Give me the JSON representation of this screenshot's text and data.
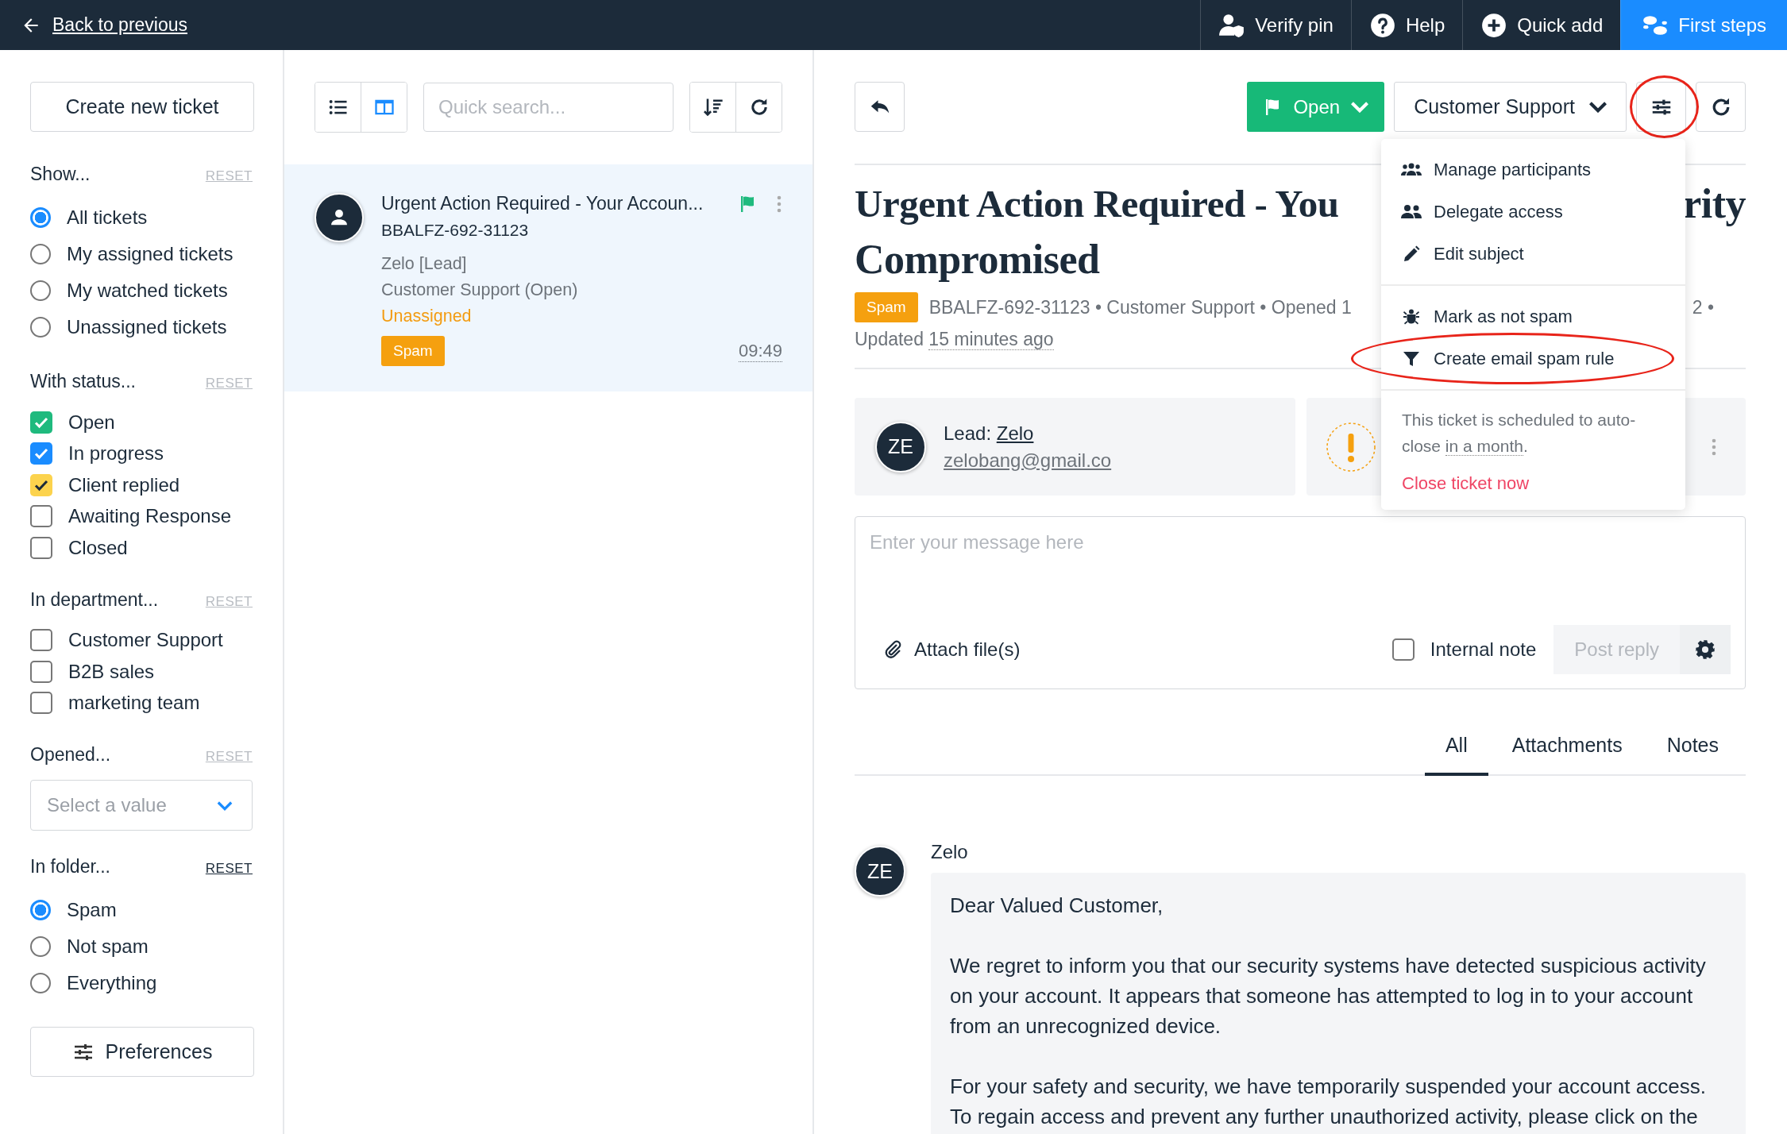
{
  "topbar": {
    "back": "Back to previous",
    "actions": [
      {
        "label": "Verify pin",
        "kind": "pin",
        "highlighted": false
      },
      {
        "label": "Help",
        "kind": "help",
        "highlighted": false
      },
      {
        "label": "Quick add",
        "kind": "add",
        "highlighted": false
      },
      {
        "label": "First steps",
        "kind": "steps",
        "highlighted": true
      }
    ]
  },
  "sidebar": {
    "create_button": "Create new ticket",
    "filters": [
      {
        "title": "Show...",
        "reset": "RESET",
        "reset_enabled": false,
        "kind": "radio",
        "options": [
          {
            "label": "All tickets",
            "selected": true
          },
          {
            "label": "My assigned tickets",
            "selected": false
          },
          {
            "label": "My watched tickets",
            "selected": false
          },
          {
            "label": "Unassigned tickets",
            "selected": false
          }
        ]
      },
      {
        "title": "With status...",
        "reset": "RESET",
        "reset_enabled": false,
        "kind": "checkbox",
        "options": [
          {
            "label": "Open",
            "checked": true,
            "color": "#1fba7e"
          },
          {
            "label": "In progress",
            "checked": true,
            "color": "#1a8cff"
          },
          {
            "label": "Client replied",
            "checked": true,
            "color": "#fcd34d"
          },
          {
            "label": "Awaiting Response",
            "checked": false
          },
          {
            "label": "Closed",
            "checked": false
          }
        ]
      },
      {
        "title": "In department...",
        "reset": "RESET",
        "reset_enabled": false,
        "kind": "checkbox",
        "options": [
          {
            "label": "Customer Support",
            "checked": false
          },
          {
            "label": "B2B sales",
            "checked": false
          },
          {
            "label": "marketing team",
            "checked": false
          }
        ]
      },
      {
        "title": "Opened...",
        "reset": "RESET",
        "reset_enabled": false,
        "kind": "select",
        "placeholder": "Select a value"
      },
      {
        "title": "In folder...",
        "reset": "RESET",
        "reset_enabled": true,
        "kind": "radio",
        "options": [
          {
            "label": "Spam",
            "selected": true
          },
          {
            "label": "Not spam",
            "selected": false
          },
          {
            "label": "Everything",
            "selected": false
          }
        ]
      }
    ],
    "preferences": "Preferences"
  },
  "ticket_list": {
    "view_modes": [
      {
        "kind": "list",
        "selected": false
      },
      {
        "kind": "split",
        "selected": true
      }
    ],
    "search": {
      "placeholder": "Quick search..."
    },
    "tickets": [
      {
        "subject": "Urgent Action Required - Your Accoun...",
        "number": "BBALFZ-692-31123",
        "contact": "Zelo [Lead]",
        "department": "Customer Support (Open)",
        "assignee": "Unassigned",
        "tag": "Spam",
        "time": "09:49",
        "flagged": true,
        "selected": true
      }
    ]
  },
  "ticket": {
    "status_button": "Open",
    "department_select": "Customer Support",
    "settings_circled": true,
    "title": {
      "line_1_start": "Urgent Action Required - You",
      "line_1_end": "rity",
      "line_2": "Compromised"
    },
    "tag": "Spam",
    "meta": {
      "start": "BBALFZ-692-31123 • Customer Support • Opened 1",
      "end": "2 •",
      "updated_label": "Updated",
      "updated_time": "15 minutes ago"
    },
    "contact": {
      "initials": "ZE",
      "role": "Lead:",
      "name": "Zelo",
      "email": "zelobang@gmail.co"
    },
    "composer": {
      "placeholder": "Enter your message here",
      "attach": "Attach file(s)",
      "internal_note": {
        "label": "Internal note",
        "checked": false
      },
      "post": {
        "label": "Post reply",
        "disabled": true
      }
    },
    "tabs": [
      {
        "label": "All",
        "selected": true
      },
      {
        "label": "Attachments",
        "selected": false
      },
      {
        "label": "Notes",
        "selected": false
      }
    ],
    "messages": [
      {
        "author": "Zelo",
        "initials": "ZE",
        "paragraphs": [
          "Dear Valued Customer,",
          "We regret to inform you that our security systems have detected suspicious activity on your account. It appears that someone has attempted to log in to your account from an unrecognized device.",
          "For your safety and security, we have temporarily suspended your account access. To regain access and prevent any further unauthorized activity, please click on the"
        ]
      }
    ]
  },
  "menu": {
    "groups": [
      [
        {
          "label": "Manage participants",
          "kind": "participants",
          "circled": false
        },
        {
          "label": "Delegate access",
          "kind": "delegate",
          "circled": false
        },
        {
          "label": "Edit subject",
          "kind": "edit",
          "circled": false
        }
      ],
      [
        {
          "label": "Mark as not spam",
          "kind": "bug",
          "circled": false
        },
        {
          "label": "Create email spam rule",
          "kind": "filter",
          "circled": true
        }
      ]
    ],
    "notice": {
      "start": "This ticket is scheduled to auto-close",
      "time": "in a month",
      "end": "."
    },
    "close_action": "Close ticket now"
  }
}
